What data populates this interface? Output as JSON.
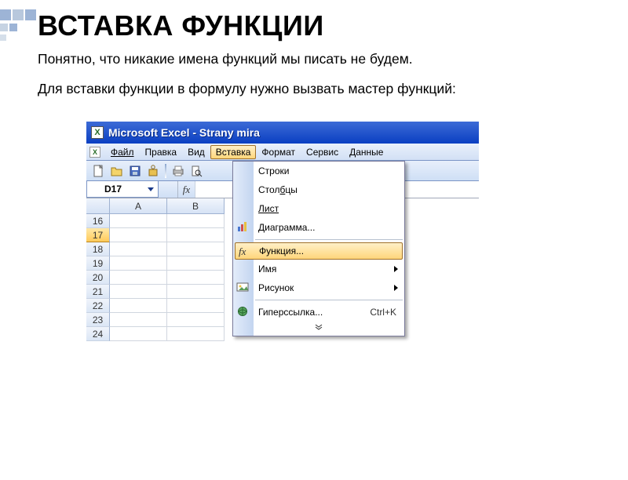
{
  "slide": {
    "title": "ВСТАВКА ФУНКЦИИ",
    "p1": "Понятно, что никакие имена функций мы писать не будем.",
    "p2": "Для вставки функции в формулу нужно вызвать мастер функций:"
  },
  "window": {
    "title": "Microsoft Excel - Strany mira"
  },
  "menubar": {
    "file": "Файл",
    "edit": "Правка",
    "view": "Вид",
    "insert": "Вставка",
    "format": "Формат",
    "tools": "Сервис",
    "data": "Данные"
  },
  "namebox": {
    "value": "D17"
  },
  "columns": [
    "A",
    "B"
  ],
  "rows": [
    "16",
    "17",
    "18",
    "19",
    "20",
    "21",
    "22",
    "23",
    "24"
  ],
  "selected_row": "17",
  "menu": {
    "rows": "Строки",
    "cols": "Столбцы",
    "sheet": "Лист",
    "chart": "Диаграмма...",
    "func": "Функция...",
    "name": "Имя",
    "picture": "Рисунок",
    "hyperlink": "Гиперссылка...",
    "hyperlink_sc": "Ctrl+K"
  }
}
